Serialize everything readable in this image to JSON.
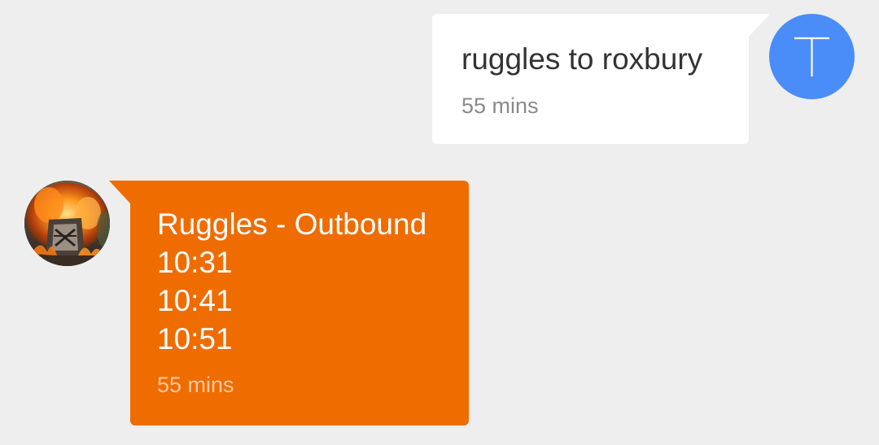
{
  "conversation": {
    "outgoing": {
      "text": "ruggles to roxbury",
      "time": "55 mins",
      "avatar_letter": "T",
      "avatar_color": "#4b8df8",
      "bubble_color": "#ffffff"
    },
    "incoming": {
      "lines": [
        "Ruggles - Outbound",
        "10:31",
        "10:41",
        "10:51"
      ],
      "time": "55 mins",
      "bubble_color": "#ef6c00",
      "avatar_icon": "burning-train-photo"
    }
  },
  "colors": {
    "background": "#eeeeee"
  }
}
